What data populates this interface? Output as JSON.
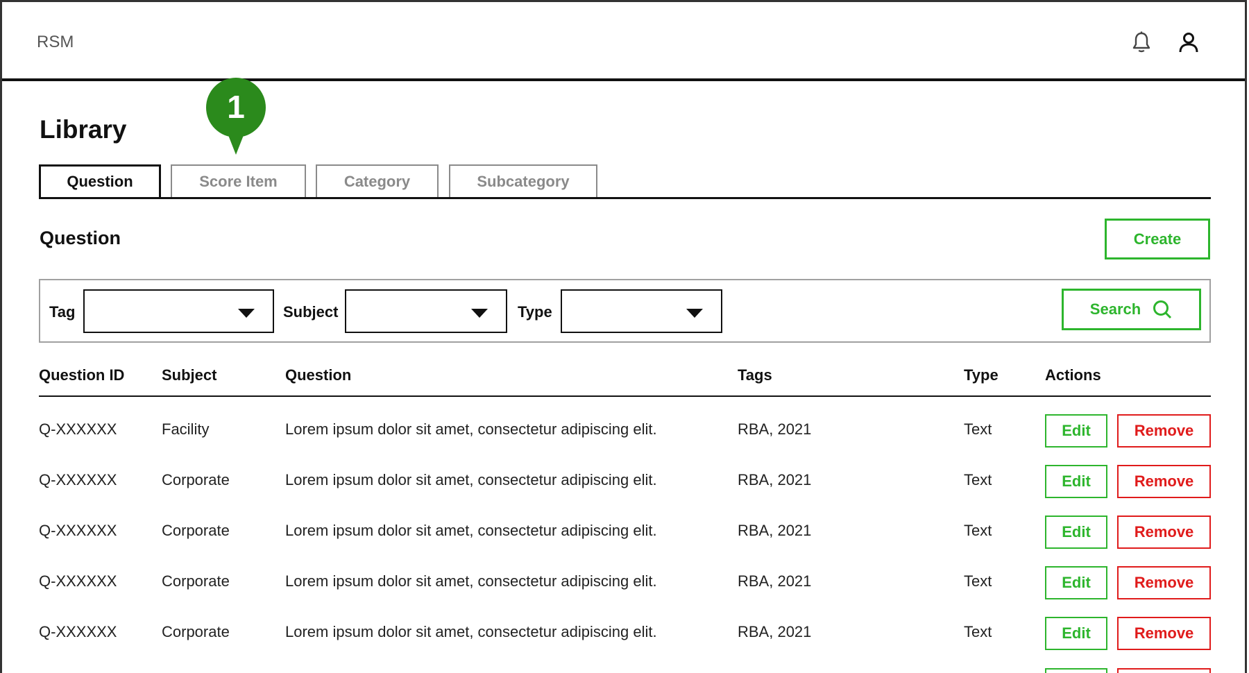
{
  "app": {
    "brand": "RSM",
    "icons": [
      "bell-icon",
      "user-icon"
    ]
  },
  "page": {
    "title": "Library",
    "marker_number": "1",
    "colors": {
      "accent_green": "#2db52d",
      "danger_red": "#e01b1b",
      "marker_green": "#2b8a1c"
    }
  },
  "tabs": [
    {
      "label": "Question",
      "active": true
    },
    {
      "label": "Score Item",
      "active": false
    },
    {
      "label": "Category",
      "active": false
    },
    {
      "label": "Subcategory",
      "active": false
    }
  ],
  "section": {
    "title": "Question",
    "create_label": "Create"
  },
  "filters": {
    "tag_label": "Tag",
    "tag_value": "",
    "subject_label": "Subject",
    "subject_value": "",
    "type_label": "Type",
    "type_value": "",
    "search_label": "Search"
  },
  "table": {
    "headers": [
      "Question ID",
      "Subject",
      "Question",
      "Tags",
      "Type",
      "Actions"
    ],
    "edit_label": "Edit",
    "remove_label": "Remove",
    "rows": [
      {
        "id": "Q-XXXXXX",
        "subject": "Facility",
        "question": "Lorem ipsum dolor sit amet, consectetur adipiscing elit.",
        "tags": "RBA, 2021",
        "type": "Text"
      },
      {
        "id": "Q-XXXXXX",
        "subject": "Corporate",
        "question": "Lorem ipsum dolor sit amet, consectetur adipiscing elit.",
        "tags": "RBA, 2021",
        "type": "Text"
      },
      {
        "id": "Q-XXXXXX",
        "subject": "Corporate",
        "question": "Lorem ipsum dolor sit amet, consectetur adipiscing elit.",
        "tags": "RBA, 2021",
        "type": "Text"
      },
      {
        "id": "Q-XXXXXX",
        "subject": "Corporate",
        "question": "Lorem ipsum dolor sit amet, consectetur adipiscing elit.",
        "tags": "RBA, 2021",
        "type": "Text"
      },
      {
        "id": "Q-XXXXXX",
        "subject": "Corporate",
        "question": "Lorem ipsum dolor sit amet, consectetur adipiscing elit.",
        "tags": "RBA, 2021",
        "type": "Text"
      }
    ]
  }
}
